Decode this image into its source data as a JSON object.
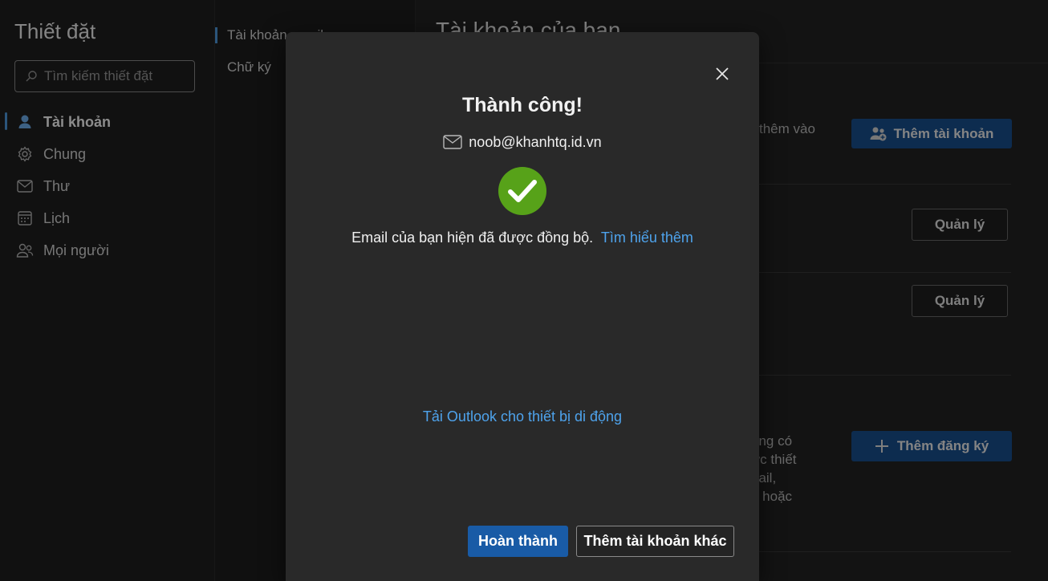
{
  "sidebar": {
    "title": "Thiết đặt",
    "search_placeholder": "Tìm kiếm thiết đặt",
    "items": [
      {
        "label": "Tài khoản",
        "icon": "person-icon"
      },
      {
        "label": "Chung",
        "icon": "gear-icon"
      },
      {
        "label": "Thư",
        "icon": "mail-icon"
      },
      {
        "label": "Lịch",
        "icon": "calendar-icon"
      },
      {
        "label": "Mọi người",
        "icon": "people-icon"
      }
    ]
  },
  "subnav": {
    "items": [
      {
        "label": "Tài khoản email"
      },
      {
        "label": "Chữ ký"
      }
    ]
  },
  "main": {
    "title": "Tài khoản của bạn",
    "text_fragment_1": "thêm vào",
    "add_account_label": "Thêm tài khoản",
    "manage_label_1": "Quản lý",
    "manage_label_2": "Quản lý",
    "text_fragment_2": "ông có\nớc thiết\nnail,\nn hoặc",
    "add_subscription_label": "Thêm đăng ký"
  },
  "dialog": {
    "title": "Thành công!",
    "email": "noob@khanhtq.id.vn",
    "message": "Email của bạn hiện đã được đồng bộ.",
    "learn_more": "Tìm hiểu thêm",
    "mobile_link": "Tải Outlook cho thiết bị di động",
    "done_label": "Hoàn thành",
    "add_other_label": "Thêm tài khoản khác"
  },
  "colors": {
    "accent": "#195ba6",
    "link": "#4ea3ec",
    "success": "#57a219",
    "dialog_bg": "#292929"
  }
}
